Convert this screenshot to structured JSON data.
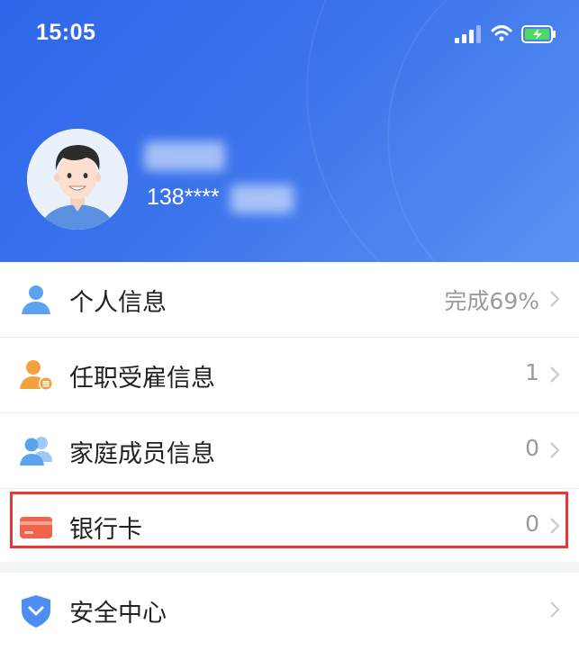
{
  "status_bar": {
    "time": "15:05"
  },
  "profile": {
    "phone": "138****"
  },
  "menu": [
    {
      "label": "个人信息",
      "value": "完成69%",
      "icon": "person-icon"
    },
    {
      "label": "任职受雇信息",
      "value": "1",
      "icon": "employment-icon"
    },
    {
      "label": "家庭成员信息",
      "value": "0",
      "icon": "family-icon"
    },
    {
      "label": "银行卡",
      "value": "0",
      "icon": "bank-card-icon"
    }
  ],
  "menu2": [
    {
      "label": "安全中心",
      "icon": "shield-icon"
    }
  ],
  "colors": {
    "header_start": "#2f66ea",
    "header_end": "#5a92f2",
    "highlight": "#e23a3a",
    "icon_blue": "#5aa3ee",
    "icon_orange": "#f2a23c",
    "card_red": "#f0644c"
  }
}
